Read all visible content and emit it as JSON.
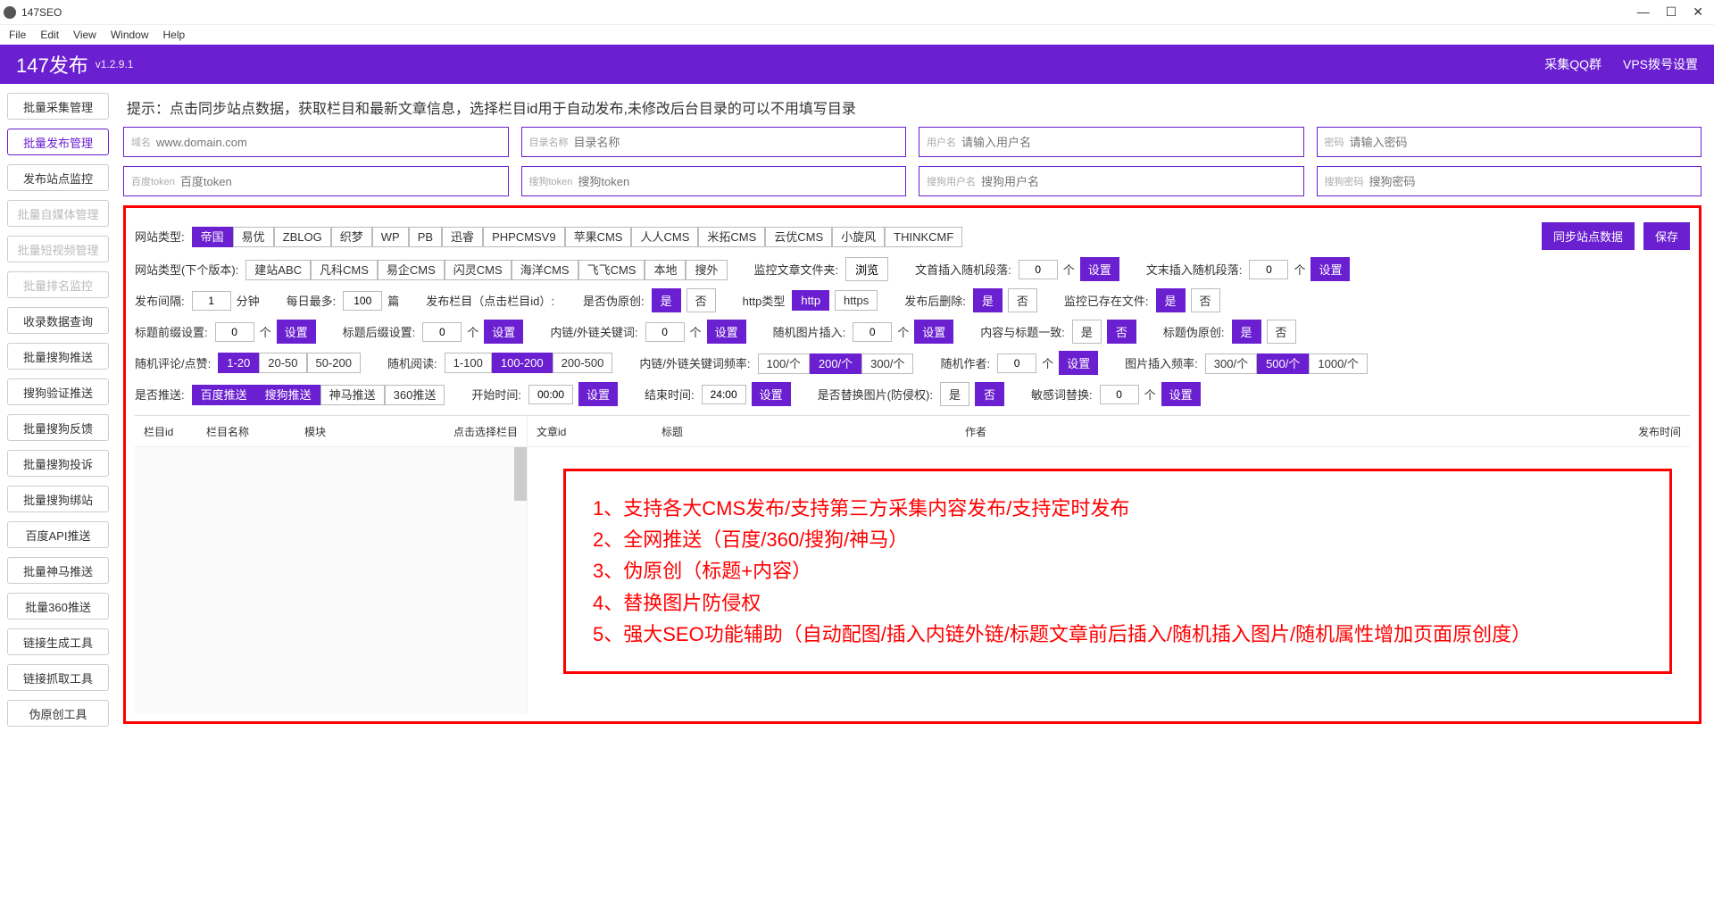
{
  "app": {
    "title": "147SEO",
    "brand": "147发布",
    "version": "v1.2.9.1"
  },
  "menu": [
    "File",
    "Edit",
    "View",
    "Window",
    "Help"
  ],
  "header_links": [
    "采集QQ群",
    "VPS拨号设置"
  ],
  "sidebar": {
    "items": [
      {
        "label": "批量采集管理",
        "state": ""
      },
      {
        "label": "批量发布管理",
        "state": "active"
      },
      {
        "label": "发布站点监控",
        "state": ""
      },
      {
        "label": "批量自媒体管理",
        "state": "disabled"
      },
      {
        "label": "批量短视频管理",
        "state": "disabled"
      },
      {
        "label": "批量排名监控",
        "state": "disabled"
      },
      {
        "label": "收录数据查询",
        "state": ""
      },
      {
        "label": "批量搜狗推送",
        "state": ""
      },
      {
        "label": "搜狗验证推送",
        "state": ""
      },
      {
        "label": "批量搜狗反馈",
        "state": ""
      },
      {
        "label": "批量搜狗投诉",
        "state": ""
      },
      {
        "label": "批量搜狗绑站",
        "state": ""
      },
      {
        "label": "百度API推送",
        "state": ""
      },
      {
        "label": "批量神马推送",
        "state": ""
      },
      {
        "label": "批量360推送",
        "state": ""
      },
      {
        "label": "链接生成工具",
        "state": ""
      },
      {
        "label": "链接抓取工具",
        "state": ""
      },
      {
        "label": "伪原创工具",
        "state": ""
      }
    ]
  },
  "tip": "提示：点击同步站点数据，获取栏目和最新文章信息，选择栏目id用于自动发布,未修改后台目录的可以不用填写目录",
  "inputs": {
    "row1": [
      {
        "lbl": "域名",
        "ph": "www.domain.com"
      },
      {
        "lbl": "目录名称",
        "ph": "目录名称"
      },
      {
        "lbl": "用户名",
        "ph": "请输入用户名"
      },
      {
        "lbl": "密码",
        "ph": "请输入密码"
      }
    ],
    "row2": [
      {
        "lbl": "百度token",
        "ph": "百度token"
      },
      {
        "lbl": "搜狗token",
        "ph": "搜狗token"
      },
      {
        "lbl": "搜狗用户名",
        "ph": "搜狗用户名"
      },
      {
        "lbl": "搜狗密码",
        "ph": "搜狗密码"
      }
    ]
  },
  "labels": {
    "site_type": "网站类型:",
    "sync": "同步站点数据",
    "save": "保存",
    "site_type_next": "网站类型(下个版本):",
    "monitor_folder": "监控文章文件夹:",
    "browse": "浏览",
    "prefix_insert": "文首插入随机段落:",
    "suffix_insert": "文末插入随机段落:",
    "unit_ge": "个",
    "setting": "设置",
    "interval": "发布间隔:",
    "minute": "分钟",
    "daily_max": "每日最多:",
    "pian": "篇",
    "column": "发布栏目（点击栏目id）:",
    "pseudo": "是否伪原创:",
    "yes": "是",
    "no": "否",
    "http_type": "http类型",
    "http": "http",
    "https": "https",
    "after_delete": "发布后删除:",
    "monitor_exist": "监控已存在文件:",
    "title_prefix": "标题前缀设置:",
    "title_suffix": "标题后缀设置:",
    "inlink": "内链/外链关键词:",
    "rand_img": "随机图片插入:",
    "content_title": "内容与标题一致:",
    "title_pseudo": "标题伪原创:",
    "rand_comment": "随机评论/点赞:",
    "rand_read": "随机阅读:",
    "inlink_freq": "内链/外链关键词频率:",
    "rand_author": "随机作者:",
    "img_freq": "图片插入频率:",
    "push": "是否推送:",
    "start_time": "开始时间:",
    "end_time": "结束时间:",
    "replace_img": "是否替换图片(防侵权):",
    "sensitive": "敏感词替换:"
  },
  "site_types": [
    "帝国",
    "易优",
    "ZBLOG",
    "织梦",
    "WP",
    "PB",
    "迅睿",
    "PHPCMSV9",
    "苹果CMS",
    "人人CMS",
    "米拓CMS",
    "云优CMS",
    "小旋风",
    "THINKCMF"
  ],
  "site_types_next": [
    "建站ABC",
    "凡科CMS",
    "易企CMS",
    "闪灵CMS",
    "海洋CMS",
    "飞飞CMS",
    "本地",
    "搜外"
  ],
  "values": {
    "interval": "1",
    "daily_max": "100",
    "prefix_para": "0",
    "suffix_para": "0",
    "title_pre": "0",
    "title_suf": "0",
    "inlink": "0",
    "rand_img": "0",
    "rand_author": "0",
    "sensitive": "0",
    "start": "00:00",
    "end": "24:00"
  },
  "comment_opts": [
    "1-20",
    "20-50",
    "50-200"
  ],
  "read_opts": [
    "1-100",
    "100-200",
    "200-500"
  ],
  "freq_opts": [
    "100/个",
    "200/个",
    "300/个"
  ],
  "img_freq_opts": [
    "300/个",
    "500/个",
    "1000/个"
  ],
  "push_opts": [
    "百度推送",
    "搜狗推送",
    "神马推送",
    "360推送"
  ],
  "table_left": [
    "栏目id",
    "栏目名称",
    "模块",
    "点击选择栏目"
  ],
  "table_right": [
    "文章id",
    "标题",
    "作者",
    "发布时间"
  ],
  "features": [
    "1、支持各大CMS发布/支持第三方采集内容发布/支持定时发布",
    "2、全网推送（百度/360/搜狗/神马）",
    "3、伪原创（标题+内容）",
    "4、替换图片防侵权",
    "5、强大SEO功能辅助（自动配图/插入内链外链/标题文章前后插入/随机插入图片/随机属性增加页面原创度）"
  ]
}
